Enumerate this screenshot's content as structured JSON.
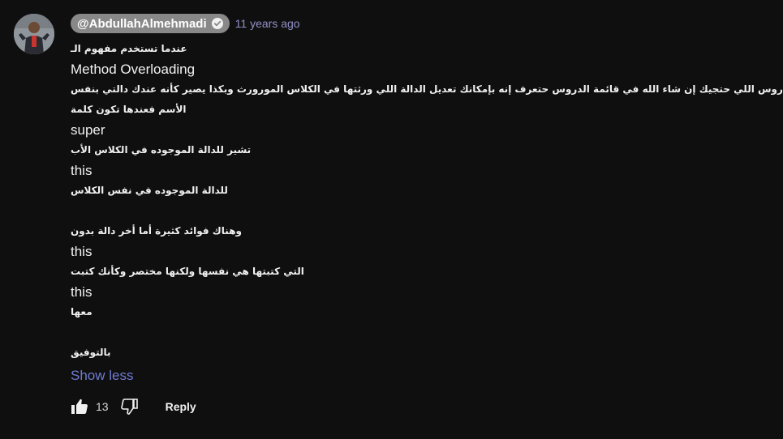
{
  "comment": {
    "author": "@AbdullahAlmehmadi",
    "timestamp": "11 years ago",
    "lines": [
      "عندما تستخدم مفهوم الـ",
      "Method Overloading",
      "في الدروس اللي حتجيك إن شاء الله في قائمة الدروس حتعرف إنه بإمكانك تعديل الدالة اللي ورثتها في الكلاس المورورث وبكذا يصير كأنه عندك دالتي بنفس",
      "الأسم فعندها تكون كلمة",
      "super",
      "تشير للدالة الموجوده في الكلاس الأب",
      "this",
      "للدالة الموجوده في نفس الكلاس",
      "",
      "وهناك فوائد كثيرة أما أخر دالة بدون",
      "this",
      "التي كتبتها هي نفسها ولكنها مختصر وكأنك كتبت",
      "this",
      "معها",
      "",
      "بالتوفيق"
    ],
    "show_less_label": "Show less"
  },
  "actions": {
    "like_count": "13",
    "reply_label": "Reply"
  },
  "icons": {
    "avatar": "avatar-photo",
    "verified": "check-circle-icon",
    "like": "thumbs-up-filled-icon",
    "dislike": "thumbs-down-outline-icon"
  },
  "colors": {
    "background": "#0f0f0f",
    "author_chip": "#888888",
    "timestamp": "#9191c9",
    "show_less": "#6f7bd0",
    "text": "#f1f1f1"
  }
}
